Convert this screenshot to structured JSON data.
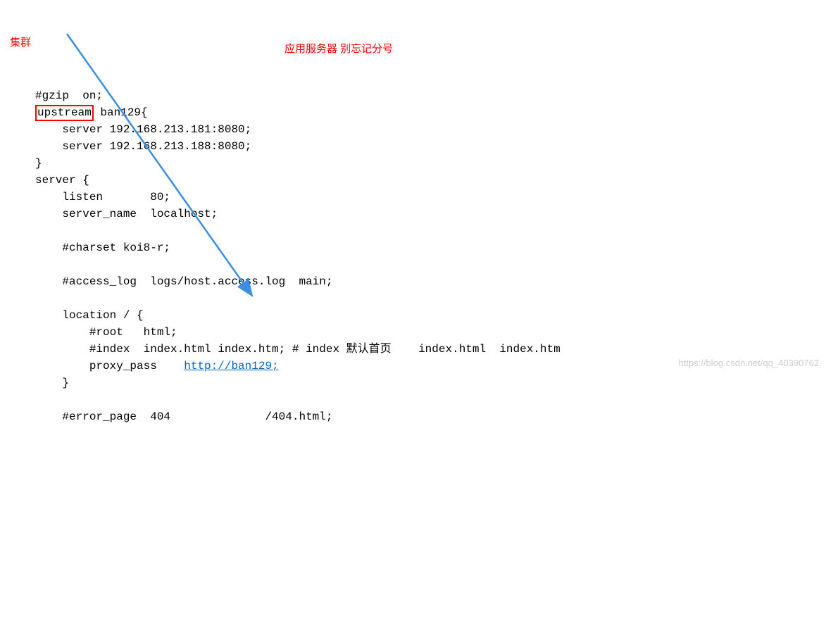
{
  "lines": {
    "l1": "#gzip  on;",
    "upstream_kw": "upstream",
    "upstream_rest": " ban129{",
    "l3": "    server 192.168.213.181:8080;",
    "l4": "    server 192.168.213.188:8080;",
    "l5": "}",
    "l6": "server {",
    "l7": "    listen       80;",
    "l8": "    server_name  localhost;",
    "l9": "",
    "l10": "    #charset koi8-r;",
    "l11": "",
    "l12": "    #access_log  logs/host.access.log  main;",
    "l13": "",
    "l14": "    location / {",
    "l15": "        #root   html;",
    "l16": "        #index  index.html index.htm; # index 默认首页    index.html  index.htm",
    "l17a": "        proxy_pass    ",
    "l17link": "http://ban129;",
    "l18": "    }",
    "l19": "",
    "l20": "    #error_page  404              /404.html;"
  },
  "annotations": {
    "cluster": "集群",
    "server_note": "应用服务器   别忘记分号"
  },
  "watermark": "https://blog.csdn.net/qq_40390762"
}
